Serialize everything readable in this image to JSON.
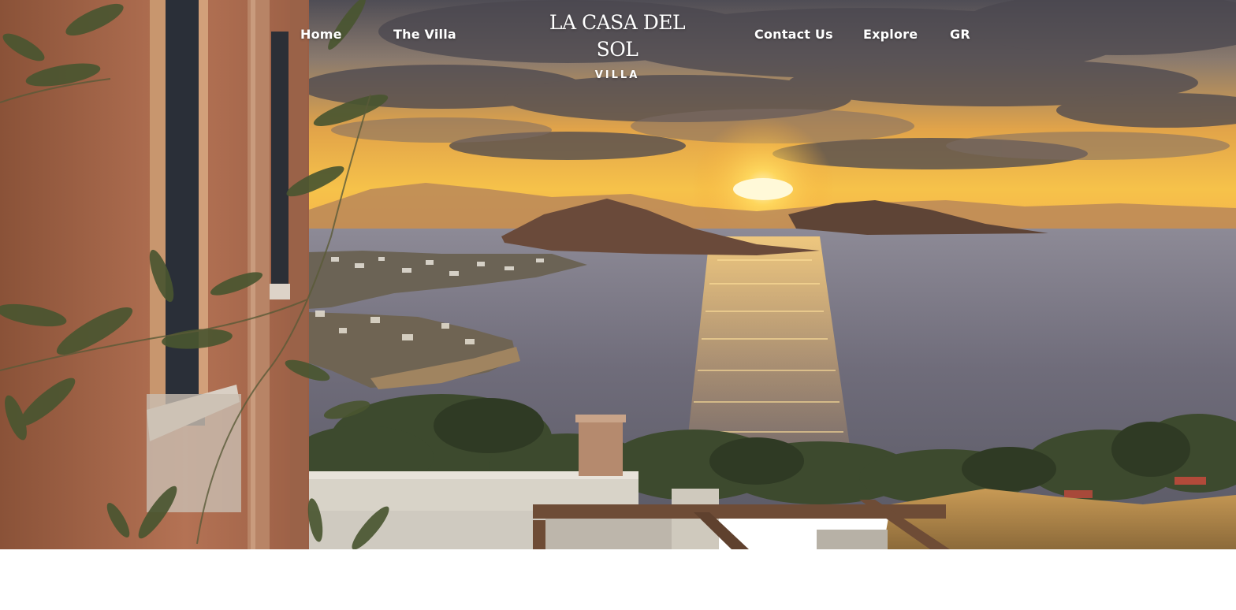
{
  "nav": {
    "home_label": "Home",
    "villa_label": "The Villa",
    "contact_label": "Contact Us",
    "explore_label": "Explore",
    "language_label": "GR"
  },
  "logo": {
    "title": "LA CASA DEL SOL",
    "subtitle": "VILLA"
  },
  "hero": {
    "image": "sunset-sea-view-photo"
  },
  "colors": {
    "nav_text": "#ffffff",
    "sky_top": "#5f5a60",
    "sun": "#ffe27a",
    "sea": "#6f6b76",
    "wall": "#a86a4a"
  }
}
